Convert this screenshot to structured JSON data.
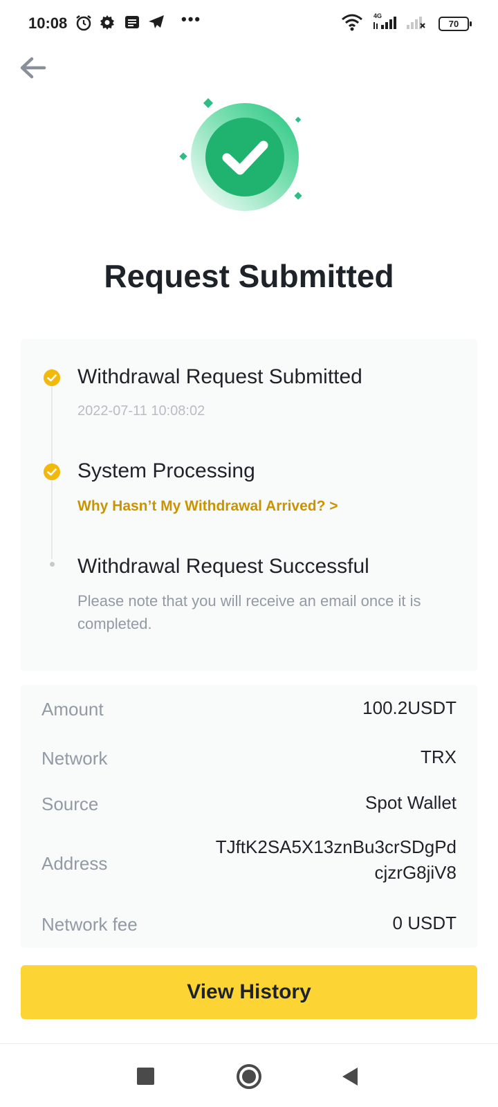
{
  "status_bar": {
    "time": "10:08",
    "battery": "70",
    "network_type": "4G",
    "icons": [
      "alarm-icon",
      "settings-icon",
      "news-icon",
      "telegram-icon",
      "more-dots-icon",
      "wifi-icon",
      "signal-icon",
      "no-signal-icon",
      "battery-icon"
    ]
  },
  "header": {
    "back_icon": "arrow-left-icon"
  },
  "hero": {
    "icon": "check-circle-icon",
    "accent_color": "#2ebd85"
  },
  "title": "Request Submitted",
  "timeline": {
    "steps": [
      {
        "title": "Withdrawal Request Submitted",
        "timestamp": "2022-07-11 10:08:02",
        "status": "done"
      },
      {
        "title": "System Processing",
        "link": "Why Hasn’t My Withdrawal Arrived? >",
        "status": "done"
      },
      {
        "title": "Withdrawal Request Successful",
        "note": "Please note that you will receive an email once it is completed.",
        "status": "pending"
      }
    ],
    "check_color": "#f0b90b",
    "link_color": "#c99400"
  },
  "details": {
    "rows": [
      {
        "label": "Amount",
        "value": "100.2USDT"
      },
      {
        "label": "Network",
        "value": "TRX"
      },
      {
        "label": "Source",
        "value": "Spot Wallet"
      },
      {
        "label": "Address",
        "value_line1": "TJftK2SA5X13znBu3crSDgPd",
        "value_line2": "cjzrG8jiV8"
      },
      {
        "label": "Network fee",
        "value": "0 USDT"
      }
    ]
  },
  "primary_button": {
    "label": "View History",
    "color": "#fcd535"
  },
  "nav_bar": {
    "icons": [
      "recents-square-icon",
      "home-circle-icon",
      "back-triangle-icon"
    ]
  }
}
